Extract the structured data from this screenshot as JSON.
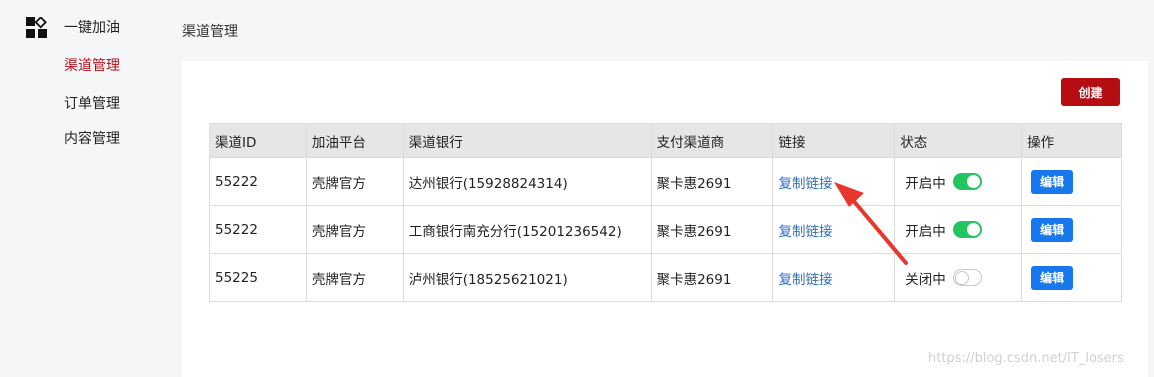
{
  "sidebar": {
    "logo_icon": "grid-logo-icon",
    "items": [
      {
        "label": "一键加油",
        "active": false
      },
      {
        "label": "渠道管理",
        "active": true
      },
      {
        "label": "订单管理",
        "active": false
      },
      {
        "label": "内容管理",
        "active": false
      }
    ]
  },
  "page": {
    "title": "渠道管理"
  },
  "toolbar": {
    "create_label": "创建"
  },
  "table": {
    "headers": [
      "渠道ID",
      "加油平台",
      "渠道银行",
      "支付渠道商",
      "链接",
      "状态",
      "操作"
    ],
    "rows": [
      {
        "id": "55222",
        "platform": "壳牌官方",
        "bank": "达州银行(15928824314)",
        "provider": "聚卡惠2691",
        "link": "复制链接",
        "status": "开启中",
        "status_on": true,
        "action": "编辑"
      },
      {
        "id": "55222",
        "platform": "壳牌官方",
        "bank": "工商银行南充分行(15201236542)",
        "provider": "聚卡惠2691",
        "link": "复制链接",
        "status": "开启中",
        "status_on": true,
        "action": "编辑"
      },
      {
        "id": "55225",
        "platform": "壳牌官方",
        "bank": "泸州银行(18525621021)",
        "provider": "聚卡惠2691",
        "link": "复制链接",
        "status": "关闭中",
        "status_on": false,
        "action": "编辑"
      }
    ]
  },
  "colors": {
    "accent_red": "#b50d12",
    "edit_blue": "#1777ec",
    "toggle_green": "#22c55e",
    "link_blue": "#2f6fbe",
    "annotation_red": "#e8362c"
  },
  "watermark": "https://blog.csdn.net/IT_losers"
}
